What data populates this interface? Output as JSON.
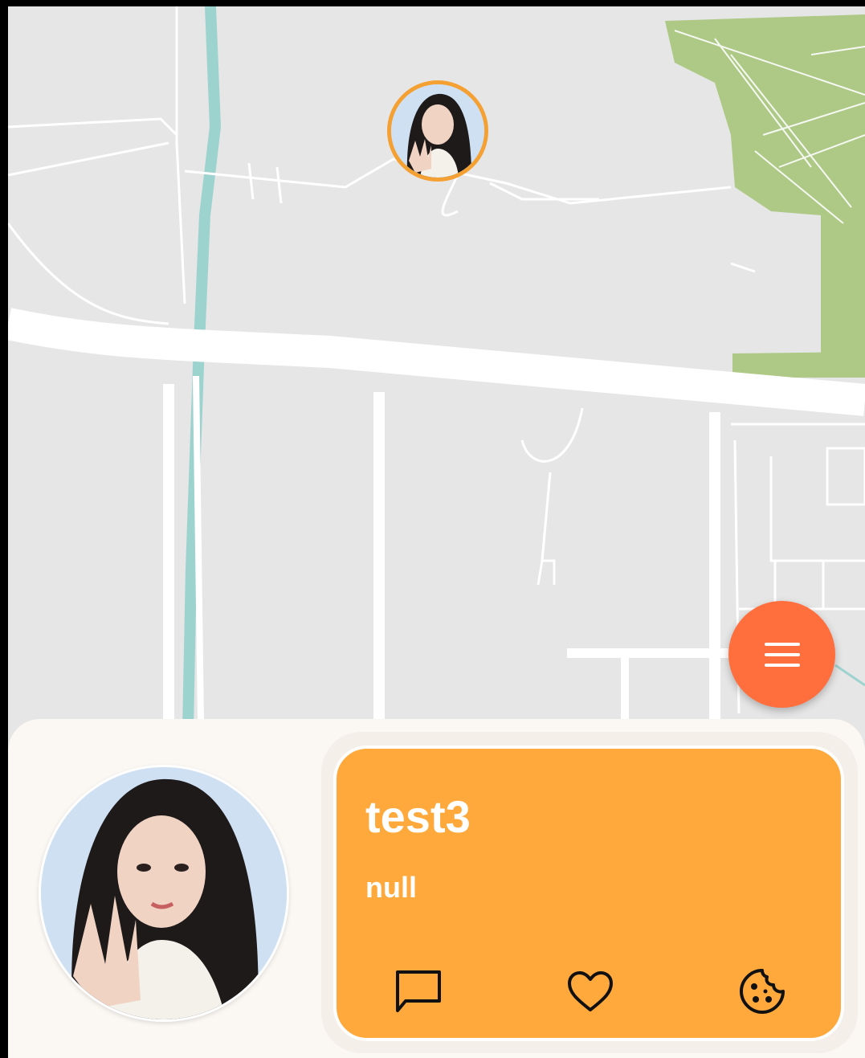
{
  "map": {
    "colors": {
      "background": "#e6e6e6",
      "road": "#ffffff",
      "park": "#adc985",
      "water": "#9dd3cf"
    }
  },
  "marker": {
    "icon": "user-avatar-photo",
    "border_color": "#f5a032"
  },
  "fab": {
    "icon": "menu-icon",
    "color": "#ff6e3c"
  },
  "profile_card": {
    "name": "test3",
    "status": "null",
    "background_color": "#ffa93d",
    "actions": [
      {
        "icon": "chat-icon"
      },
      {
        "icon": "heart-icon"
      },
      {
        "icon": "cookie-icon"
      }
    ]
  }
}
